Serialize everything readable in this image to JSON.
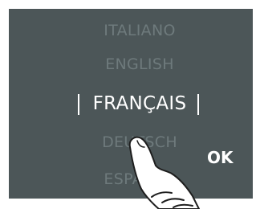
{
  "language_menu": {
    "items": [
      {
        "label": "ITALIANO",
        "selected": false
      },
      {
        "label": "ENGLISH",
        "selected": false
      },
      {
        "label": "FRANÇAIS",
        "selected": true
      },
      {
        "label": "DEUTSCH",
        "selected": false
      },
      {
        "label": "ESPAÑOL",
        "selected": false
      }
    ]
  },
  "ok_button": {
    "label": "OK"
  },
  "colors": {
    "screen_background": "#4c5658",
    "inactive_text": "#6e7a7c",
    "active_text": "#ffffff"
  },
  "icons": {
    "pointer": "touch-hand-icon"
  }
}
